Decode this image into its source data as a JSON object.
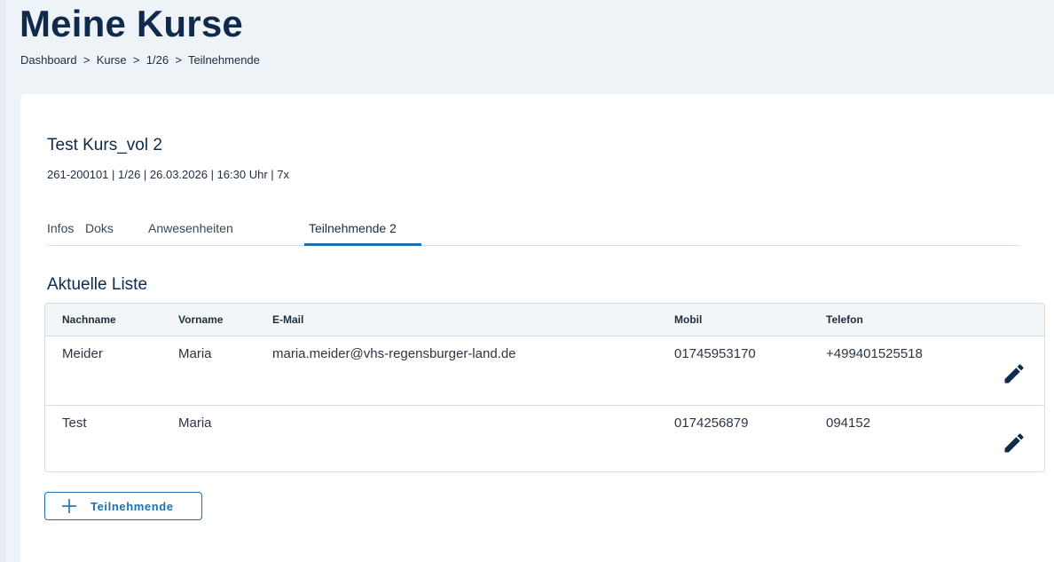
{
  "header": {
    "title": "Meine Kurse",
    "breadcrumb": [
      "Dashboard",
      "Kurse",
      "1/26",
      "Teilnehmende"
    ],
    "breadcrumb_separator": ">"
  },
  "course": {
    "title": "Test Kurs_vol 2",
    "meta": "261-200101 | 1/26 | 26.03.2026 | 16:30 Uhr | 7x"
  },
  "tabs": [
    {
      "label": "Infos",
      "active": false
    },
    {
      "label": "Doks",
      "active": false
    },
    {
      "label": "Anwesenheiten",
      "active": false
    },
    {
      "label": "Teilnehmende 2",
      "active": true
    }
  ],
  "list": {
    "title": "Aktuelle Liste",
    "columns": [
      "Nachname",
      "Vorname",
      "E-Mail",
      "Mobil",
      "Telefon"
    ],
    "rows": [
      {
        "nachname": "Meider",
        "vorname": "Maria",
        "email": "maria.meider@vhs-regensburger-land.de",
        "mobil": "01745953170",
        "telefon": "+499401525518"
      },
      {
        "nachname": "Test",
        "vorname": "Maria",
        "email": "",
        "mobil": "0174256879",
        "telefon": "094152"
      }
    ],
    "row_action_icon": "pencil-icon"
  },
  "add_button": {
    "label": "Teilnehmende",
    "icon": "plus-icon"
  },
  "colors": {
    "accent": "#1c6fb3",
    "title": "#0f2a4a",
    "background": "#eef3f8"
  }
}
